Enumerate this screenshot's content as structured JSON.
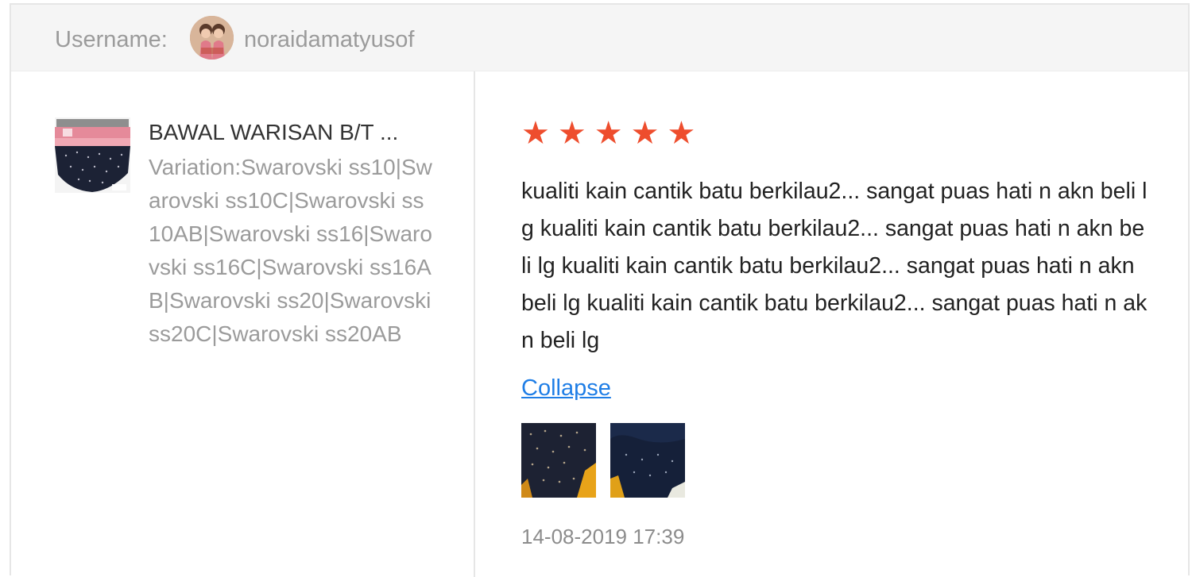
{
  "header": {
    "username_label": "Username:",
    "username": "noraidamatyusof"
  },
  "product": {
    "title": "BAWAL WARISAN B/T ...",
    "variation": "Variation:Swarovski ss10|Swarovski ss10C|Swarovski ss10AB|Swarovski ss16|Swarovski ss16C|Swarovski ss16AB|Swarovski ss20|Swarovski ss20C|Swarovski ss20AB"
  },
  "review": {
    "rating": 5,
    "rating_max": 5,
    "star_glyph": "★",
    "star_color": "#ee4d2d",
    "text": "kualiti kain cantik batu berkilau2... sangat puas hati n akn beli lg kualiti kain cantik batu berkilau2... sangat puas hati n akn beli lg kualiti kain cantik batu berkilau2... sangat puas hati n akn beli lg kualiti kain cantik batu berkilau2... sangat puas hati n akn beli lg",
    "collapse_label": "Collapse",
    "timestamp": "14-08-2019 17:39",
    "link_color": "#1f7ee6"
  },
  "icons": {
    "avatar": "user-avatar-icon",
    "product_thumb": "product-thumbnail",
    "review_photo": "review-photo"
  }
}
